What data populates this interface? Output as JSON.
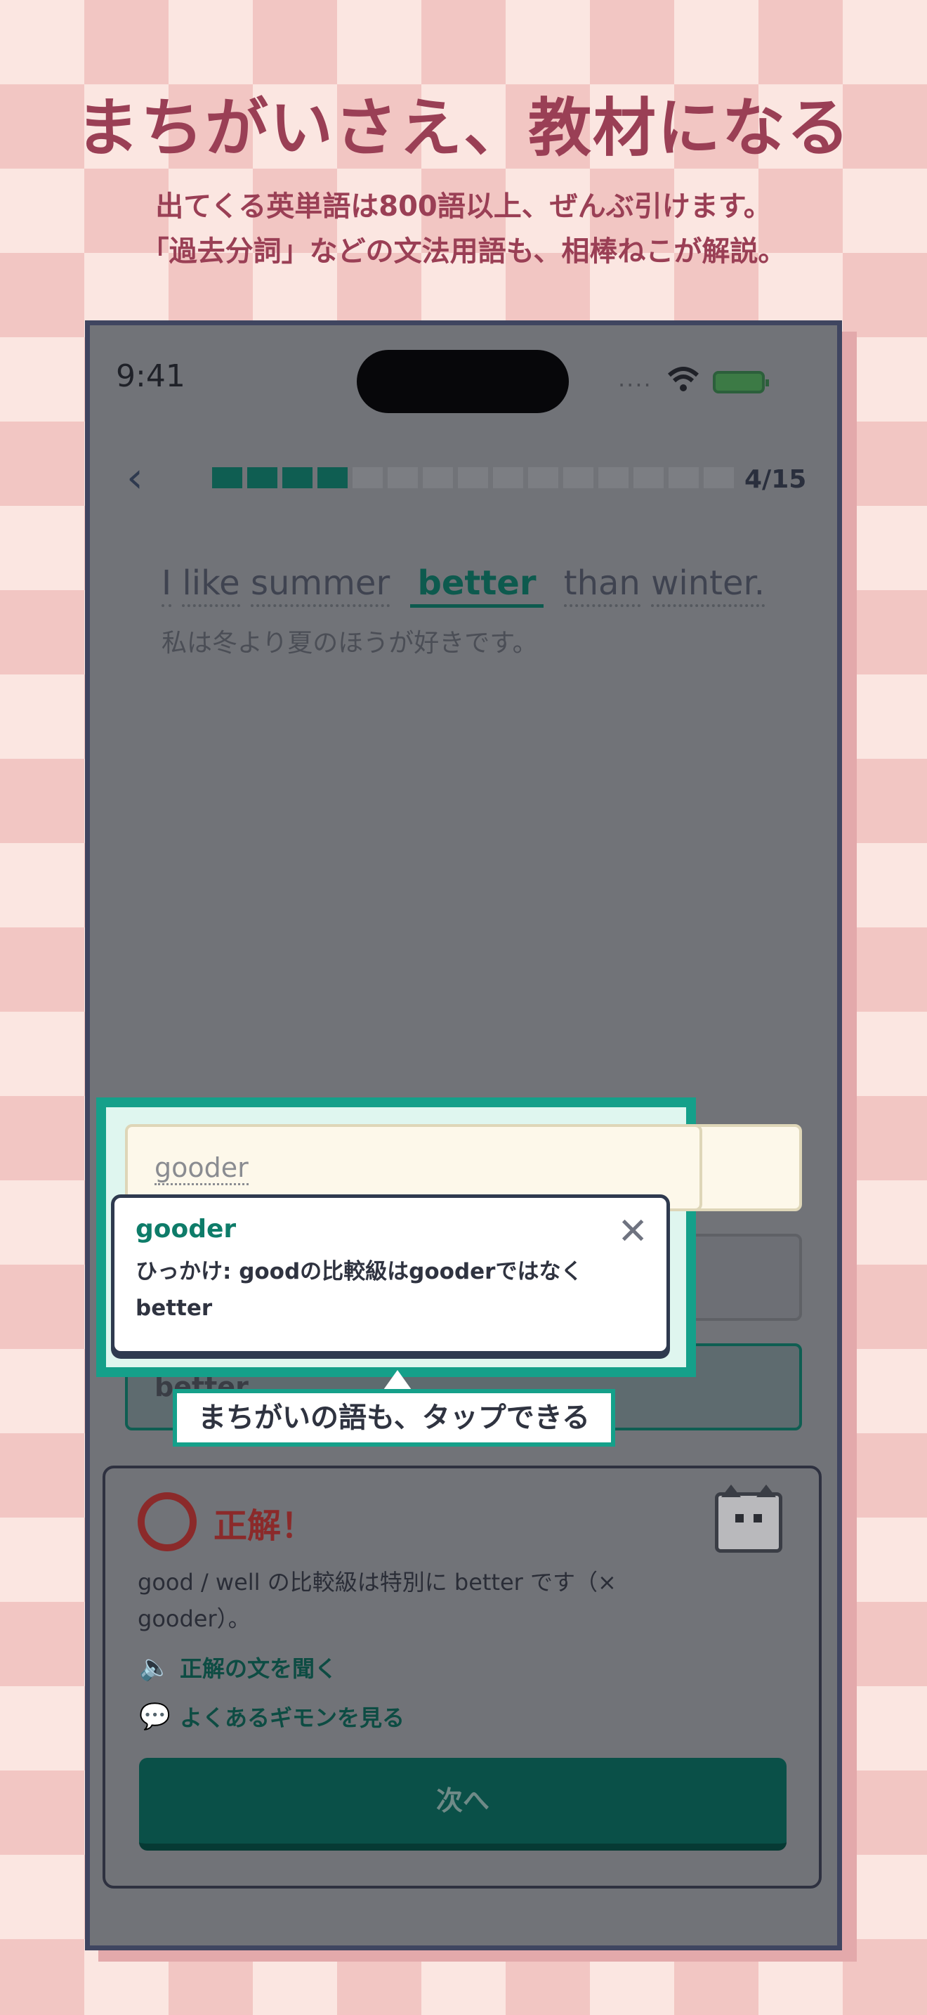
{
  "promo": {
    "headline": "まちがいさえ、教材になる",
    "sub1": "出てくる英単語は800語以上、ぜんぶ引けます。",
    "sub2": "「過去分詞」などの文法用語も、相棒ねこが解説。"
  },
  "status": {
    "time": "9:41",
    "dots": "....",
    "wifi_icon": "wifi-icon",
    "battery_icon": "battery-charging-icon"
  },
  "quiz": {
    "progress_label": "4/15",
    "progress_current": 4,
    "progress_total": 15,
    "sentence_before": [
      "I",
      "like",
      "summer"
    ],
    "sentence_answer": "better",
    "sentence_after": [
      "than",
      "winter."
    ],
    "translation": "私は冬より夏のほうが好きです。"
  },
  "options": {
    "opt1": "gooder",
    "opt2": "",
    "opt3": "better"
  },
  "tooltip": {
    "title": "gooder",
    "body_line1": "ひっかけ: goodの比較級はgooderではなく",
    "body_line2": "better",
    "close_icon": "close-icon"
  },
  "callout": {
    "text": "まちがいの語も、タップできる"
  },
  "feedback": {
    "title": "正解！",
    "explanation_line1": "good / well の比較級は特別に better です（×",
    "explanation_line2": "gooder）。",
    "link_listen": "正解の文を聞く",
    "link_faq": "よくあるギモンを見る",
    "next_label": "次へ"
  },
  "colors": {
    "accent_teal": "#15a08a",
    "dark_teal": "#0a5048",
    "correct_red": "#8b2a2a",
    "headline_rose": "#9a3f55"
  }
}
